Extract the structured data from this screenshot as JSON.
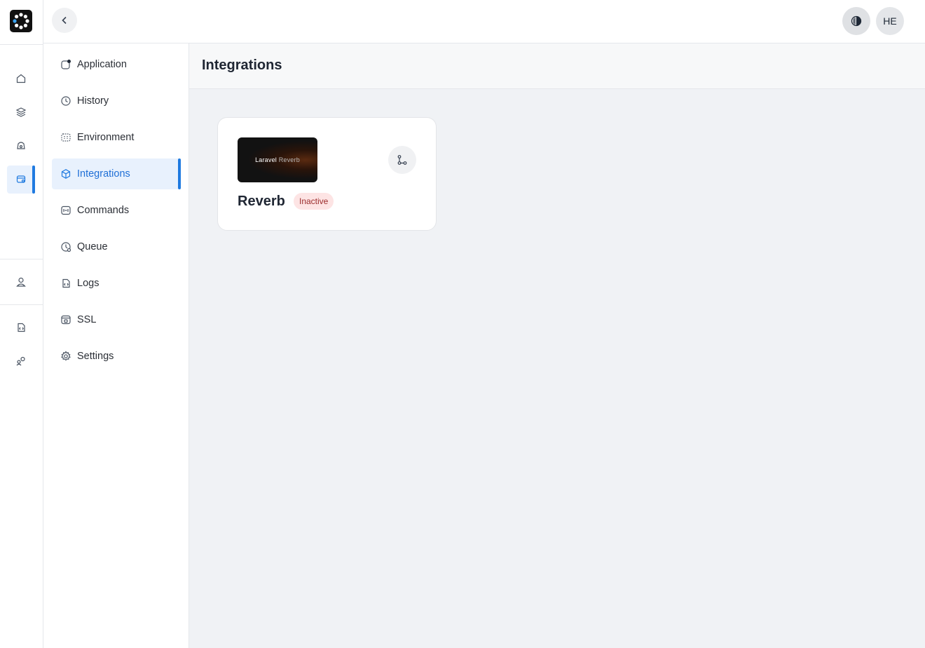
{
  "topbar": {
    "back_icon": "chevron-left-icon",
    "theme_icon": "contrast-icon",
    "avatar_initials": "HE"
  },
  "rail": {
    "logo_icon": "app-logo-icon",
    "items": [
      {
        "icon": "home-icon"
      },
      {
        "icon": "layers-icon"
      },
      {
        "icon": "server-icon"
      },
      {
        "icon": "apps-icon",
        "active": true
      },
      {
        "icon": "user-icon"
      },
      {
        "icon": "code-file-icon"
      },
      {
        "icon": "users-icon"
      }
    ]
  },
  "subnav": {
    "items": [
      {
        "label": "Application",
        "icon": "application-icon"
      },
      {
        "label": "History",
        "icon": "history-icon"
      },
      {
        "label": "Environment",
        "icon": "environment-icon"
      },
      {
        "label": "Integrations",
        "icon": "cube-icon",
        "active": true
      },
      {
        "label": "Commands",
        "icon": "terminal-icon"
      },
      {
        "label": "Queue",
        "icon": "queue-icon"
      },
      {
        "label": "Logs",
        "icon": "logs-icon"
      },
      {
        "label": "SSL",
        "icon": "ssl-icon"
      },
      {
        "label": "Settings",
        "icon": "gear-icon"
      }
    ]
  },
  "main": {
    "title": "Integrations",
    "card": {
      "thumb_text_main": "Laravel",
      "thumb_text_sub": "Reverb",
      "name": "Reverb",
      "status": "Inactive",
      "connect_icon": "connect-icon"
    }
  },
  "colors": {
    "accent": "#1f7ae0",
    "badge_bg": "#fde4e4",
    "badge_text": "#9b2c2c"
  }
}
